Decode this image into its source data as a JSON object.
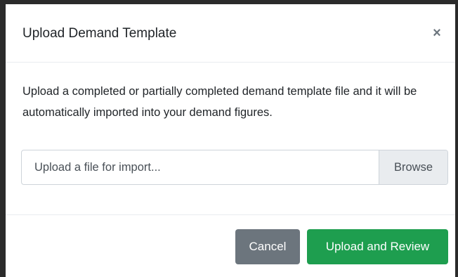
{
  "modal": {
    "title": "Upload Demand Template",
    "close_symbol": "×",
    "description": "Upload a completed or partially completed demand template file and it will be automatically imported into your demand figures.",
    "file_input": {
      "placeholder": "Upload a file for import...",
      "browse_label": "Browse"
    },
    "footer": {
      "cancel_label": "Cancel",
      "submit_label": "Upload and Review"
    }
  },
  "colors": {
    "primary_action": "#1e9e4f",
    "secondary_action": "#6c757d",
    "browse_background": "#e9ecef"
  },
  "icons": {
    "close": "close-icon"
  }
}
